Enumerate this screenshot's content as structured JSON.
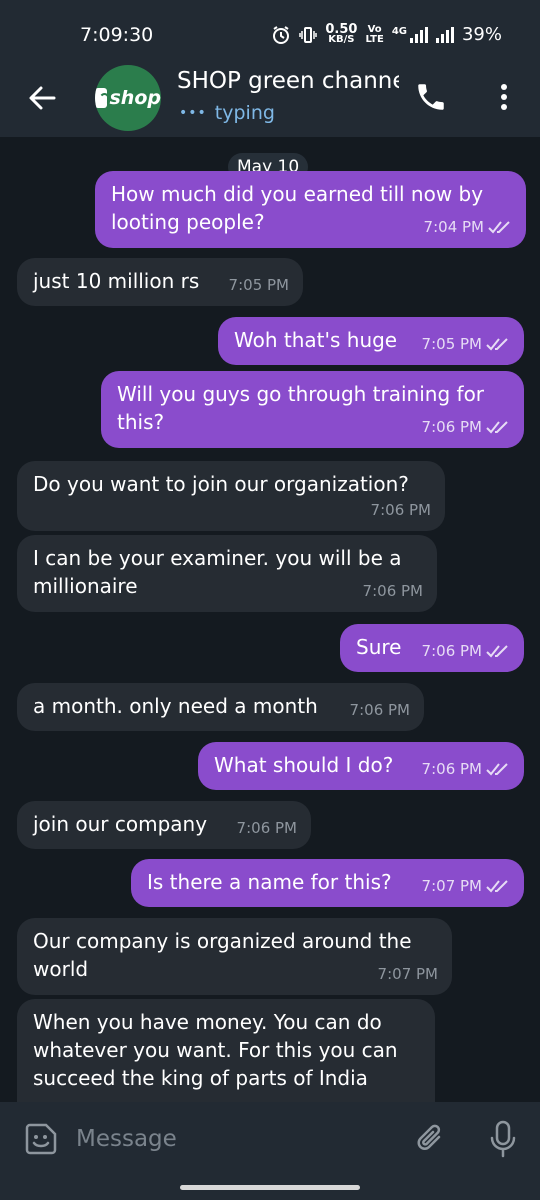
{
  "status_bar": {
    "time": "7:09:30",
    "net_speed_value": "0.50",
    "net_speed_unit": "KB/S",
    "volte_top": "Vo",
    "volte_bottom": "LTE",
    "network_type": "4G",
    "battery": "39%"
  },
  "header": {
    "avatar_text": "shop",
    "title": "SHOP green channel",
    "status": "typing"
  },
  "chat": {
    "date": "May 10",
    "messages": [
      {
        "text": "How much did you earned till now by looting people?",
        "time": "7:04 PM"
      },
      {
        "text": "just 10 million rs",
        "time": "7:05 PM"
      },
      {
        "text": "Woh that's huge",
        "time": "7:05 PM"
      },
      {
        "text": "Will you guys go through training for this?",
        "time": "7:06 PM"
      },
      {
        "text": "Do you want to join our organization?",
        "time": "7:06 PM"
      },
      {
        "text": "I can be your examiner. you will be a millionaire",
        "time": "7:06 PM"
      },
      {
        "text": "Sure",
        "time": "7:06 PM"
      },
      {
        "text": "a month. only need a month",
        "time": "7:06 PM"
      },
      {
        "text": "What should I do?",
        "time": "7:06 PM"
      },
      {
        "text": "join our company",
        "time": "7:06 PM"
      },
      {
        "text": "Is there a name for this?",
        "time": "7:07 PM"
      },
      {
        "text": "Our company is organized around the world",
        "time": "7:07 PM"
      },
      {
        "text": "When you have money. You can do whatever you want. For this you can succeed the king of parts of India",
        "time": ""
      }
    ]
  },
  "input": {
    "placeholder": "Message"
  },
  "colors": {
    "outgoing_bubble": "#8a4ccc",
    "incoming_bubble": "#262c33",
    "header_bg": "#222a33",
    "chat_bg": "#141a20",
    "accent_status": "#7fb8e6"
  },
  "icons": {
    "back": "arrow-left-icon",
    "call": "phone-icon",
    "menu": "more-vertical-icon",
    "read": "double-check-icon",
    "emoji": "sticker-emoji-icon",
    "attach": "paperclip-icon",
    "mic": "microphone-icon"
  }
}
